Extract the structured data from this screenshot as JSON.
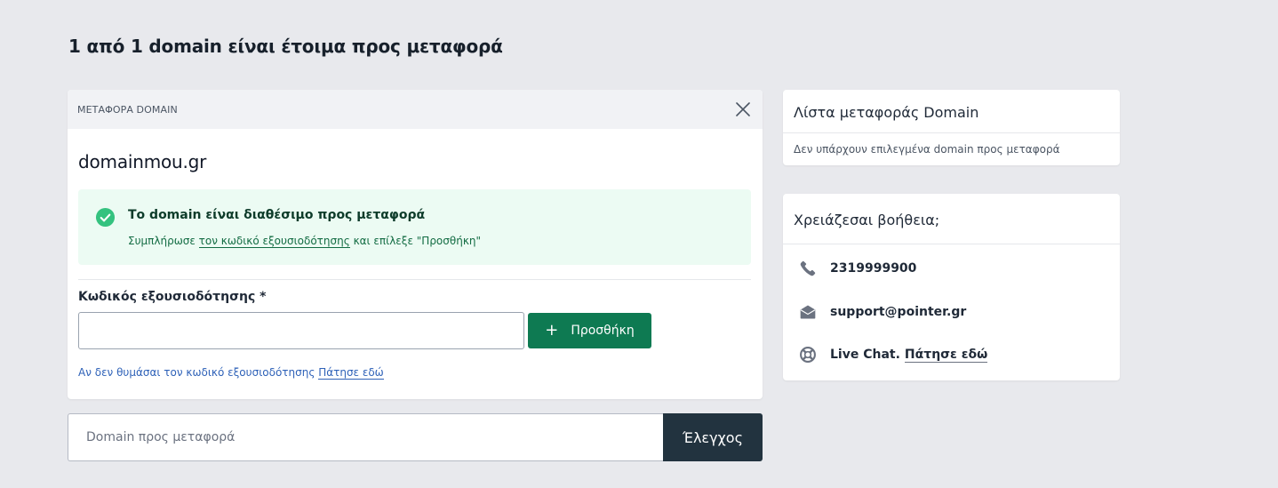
{
  "page": {
    "title": "1 από 1 domain είναι έτοιμα προς μεταφορά"
  },
  "transfer_card": {
    "header_label": "ΜΕΤΑΦΟΡΑ DOMAIN",
    "domain": "domainmou.gr",
    "success_title": "Το domain είναι διαθέσιμο προς μεταφορά",
    "success_text_before": "Συμπλήρωσε ",
    "success_text_link": "τον κωδικό εξουσιοδότησης",
    "success_text_after": " και επίλεξε \"Προσθήκη\"",
    "field_label": "Κωδικός εξουσιοδότησης *",
    "auth_value": "",
    "add_label": "Προσθήκη",
    "forgot_text": "Αν δεν θυμάσαι τον κωδικό εξουσιοδότησης ",
    "forgot_link": "Πάτησε εδώ"
  },
  "check_bar": {
    "placeholder": "Domain προς μεταφορά",
    "button_label": "Έλεγχος"
  },
  "transfer_list": {
    "title": "Λίστα μεταφοράς Domain",
    "empty_text": "Δεν υπάρχουν επιλεγμένα domain προς μεταφορά"
  },
  "help": {
    "title": "Χρειάζεσαι βοήθεια;",
    "phone": "2319999900",
    "email": "support@pointer.gr",
    "chat_label": "Live Chat.",
    "chat_link": "Πάτησε εδώ"
  },
  "colors": {
    "primary_green": "#0e7a52",
    "success_bg": "#ecfbf3",
    "dark_button": "#22333f",
    "link_blue": "#2f62b8"
  },
  "icons": {
    "close": "close-icon",
    "success": "check-circle-icon",
    "add": "plus-icon",
    "phone": "phone-icon",
    "email": "envelope-open-icon",
    "chat": "life-ring-icon"
  }
}
